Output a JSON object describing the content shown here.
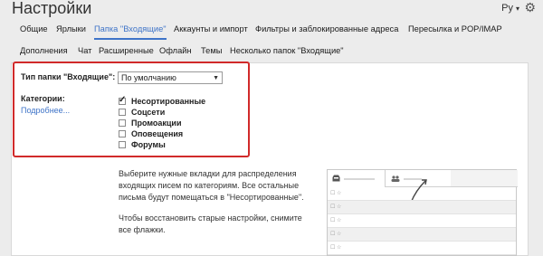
{
  "header": {
    "title": "Настройки",
    "lang": "Ру",
    "lang_caret": "▾",
    "gear_icon": "⚙"
  },
  "tabs_row1": [
    {
      "label": "Общие"
    },
    {
      "label": "Ярлыки"
    },
    {
      "label": "Папка \"Входящие\"",
      "active": true
    },
    {
      "label": "Аккаунты и импорт"
    },
    {
      "label": "Фильтры и заблокированные адреса"
    },
    {
      "label": "Пересылка и POP/IMAP"
    }
  ],
  "tabs_row2": [
    {
      "label": "Дополнения"
    },
    {
      "label": "Чат"
    },
    {
      "label": "Расширенные"
    },
    {
      "label": "Офлайн"
    },
    {
      "label": "Темы"
    },
    {
      "label": "Несколько папок \"Входящие\""
    }
  ],
  "inbox_type": {
    "label": "Тип папки \"Входящие\":",
    "selected": "По умолчанию",
    "arrow": "▼"
  },
  "categories": {
    "label": "Категории:",
    "more_link": "Подробнее...",
    "items": [
      {
        "label": "Несортированные",
        "checked": true
      },
      {
        "label": "Соцсети",
        "checked": false
      },
      {
        "label": "Промоакции",
        "checked": false
      },
      {
        "label": "Оповещения",
        "checked": false
      },
      {
        "label": "Форумы",
        "checked": false
      }
    ]
  },
  "description": {
    "p1": "Выберите нужные вкладки для распределения входящих писем по категориям. Все остальные письма будут помещаться в \"Несортированные\".",
    "p2": "Чтобы восстановить старые настройки, снимите все флажки."
  },
  "preview": {
    "tab1_icon": "inbox-icon",
    "tab2_icon": "people-icon",
    "row_glyph": "☐ ☆"
  },
  "colors": {
    "accent": "#3f74c8",
    "highlight_border": "#d12a2a",
    "background": "#ececec"
  }
}
